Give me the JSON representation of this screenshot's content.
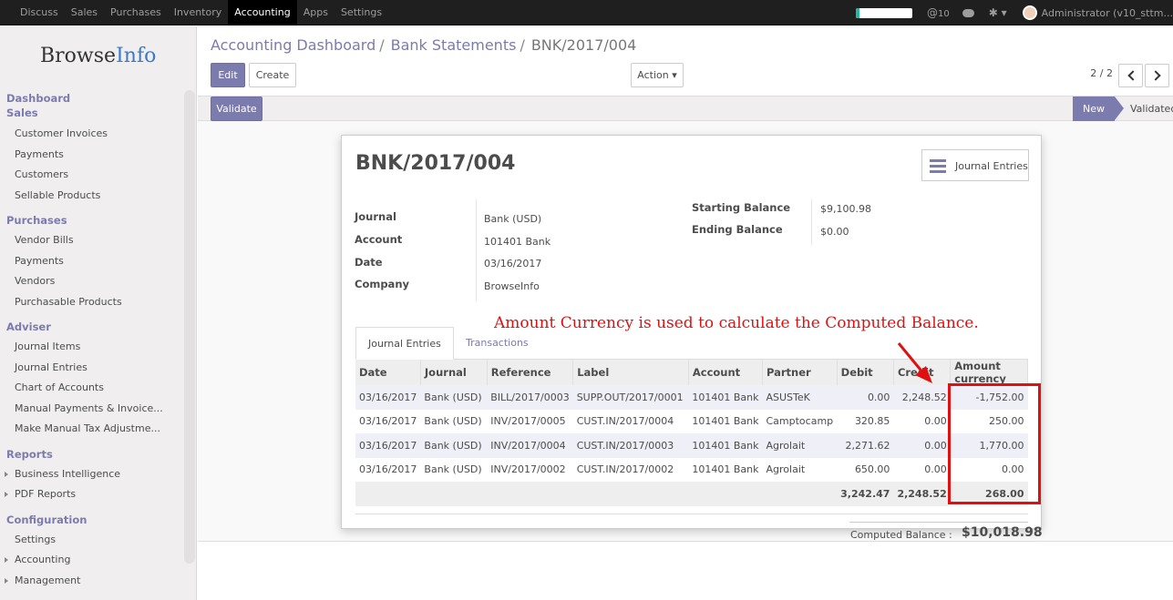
{
  "topbar": {
    "menu": [
      "Discuss",
      "Sales",
      "Purchases",
      "Inventory",
      "Accounting",
      "Apps",
      "Settings"
    ],
    "active": "Accounting",
    "messages": "10",
    "user": "Administrator (v10_sttm..."
  },
  "sidebar": {
    "logo_a": "Browse",
    "logo_b": "Info",
    "sections": [
      {
        "title": "Dashboard",
        "items": []
      },
      {
        "title": "Sales",
        "items": [
          "Customer Invoices",
          "Payments",
          "Customers",
          "Sellable Products"
        ]
      },
      {
        "title": "Purchases",
        "items": [
          "Vendor Bills",
          "Payments",
          "Vendors",
          "Purchasable Products"
        ]
      },
      {
        "title": "Adviser",
        "items": [
          "Journal Items",
          "Journal Entries",
          "Chart of Accounts",
          "Manual Payments & Invoice...",
          "Make Manual Tax Adjustme..."
        ]
      },
      {
        "title": "Reports",
        "items": [
          "Business Intelligence",
          "PDF Reports"
        ]
      },
      {
        "title": "Configuration",
        "items": [
          "Settings",
          "Accounting",
          "Management"
        ]
      }
    ]
  },
  "breadcrumb": {
    "a": "Accounting Dashboard",
    "b": "Bank Statements",
    "c": "BNK/2017/004",
    "sep": "/"
  },
  "buttons": {
    "edit": "Edit",
    "create": "Create",
    "action": "Action",
    "validate": "Validate"
  },
  "pager": "2 / 2",
  "stages": {
    "new": "New",
    "validated": "Validated"
  },
  "record": {
    "title": "BNK/2017/004",
    "je_button": "Journal Entries",
    "fields": {
      "journal_label": "Journal",
      "journal": "Bank (USD)",
      "account_label": "Account",
      "account": "101401 Bank",
      "date_label": "Date",
      "date": "03/16/2017",
      "company_label": "Company",
      "company": "BrowseInfo",
      "start_label": "Starting Balance",
      "start": "$9,100.98",
      "end_label": "Ending Balance",
      "end": "$0.00"
    },
    "tabs": [
      "Journal Entries",
      "Transactions"
    ],
    "columns": [
      "Date",
      "Journal",
      "Reference",
      "Label",
      "Account",
      "Partner",
      "Debit",
      "Credit",
      "Amount currency"
    ],
    "rows": [
      [
        "03/16/2017",
        "Bank (USD)",
        "BILL/2017/0003",
        "SUPP.OUT/2017/0001",
        "101401 Bank",
        "ASUSTeK",
        "0.00",
        "2,248.52",
        "-1,752.00"
      ],
      [
        "03/16/2017",
        "Bank (USD)",
        "INV/2017/0005",
        "CUST.IN/2017/0004",
        "101401 Bank",
        "Camptocamp",
        "320.85",
        "0.00",
        "250.00"
      ],
      [
        "03/16/2017",
        "Bank (USD)",
        "INV/2017/0004",
        "CUST.IN/2017/0003",
        "101401 Bank",
        "Agrolait",
        "2,271.62",
        "0.00",
        "1,770.00"
      ],
      [
        "03/16/2017",
        "Bank (USD)",
        "INV/2017/0002",
        "CUST.IN/2017/0002",
        "101401 Bank",
        "Agrolait",
        "650.00",
        "0.00",
        "0.00"
      ]
    ],
    "totals": {
      "debit": "3,242.47",
      "credit": "2,248.52",
      "amount": "268.00"
    },
    "computed_label": "Computed Balance :",
    "computed_value": "$10,018.98"
  },
  "annotation": "Amount Currency is used to calculate the Computed Balance.",
  "colors": {
    "accent": "#7c7bad",
    "annotation": "#e01010"
  }
}
